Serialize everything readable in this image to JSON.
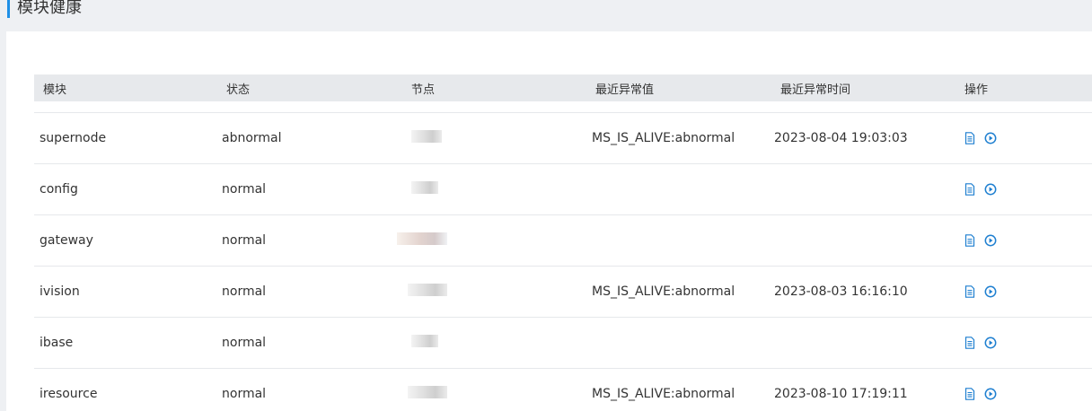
{
  "header": {
    "title": "模块健康"
  },
  "table": {
    "columns": [
      "模块",
      "状态",
      "节点",
      "最近异常值",
      "最近异常时间",
      "操作"
    ],
    "rows": [
      {
        "module": "supernode",
        "status": "abnormal",
        "last_abnormal_value": "MS_IS_ALIVE:abnormal",
        "last_abnormal_time": "2023-08-04 19:03:03"
      },
      {
        "module": "config",
        "status": "normal",
        "last_abnormal_value": "",
        "last_abnormal_time": ""
      },
      {
        "module": "gateway",
        "status": "normal",
        "last_abnormal_value": "",
        "last_abnormal_time": ""
      },
      {
        "module": "ivision",
        "status": "normal",
        "last_abnormal_value": "MS_IS_ALIVE:abnormal",
        "last_abnormal_time": "2023-08-03 16:16:10"
      },
      {
        "module": "ibase",
        "status": "normal",
        "last_abnormal_value": "",
        "last_abnormal_time": ""
      },
      {
        "module": "iresource",
        "status": "normal",
        "last_abnormal_value": "MS_IS_ALIVE:abnormal",
        "last_abnormal_time": "2023-08-10 17:19:11"
      }
    ],
    "action_icons": [
      "document-icon",
      "play-circle-icon"
    ]
  },
  "colors": {
    "accent": "#1e8fe6",
    "icon": "#1e7fd0",
    "header_bg": "#e7e9ec",
    "page_bg": "#eef0f3"
  }
}
